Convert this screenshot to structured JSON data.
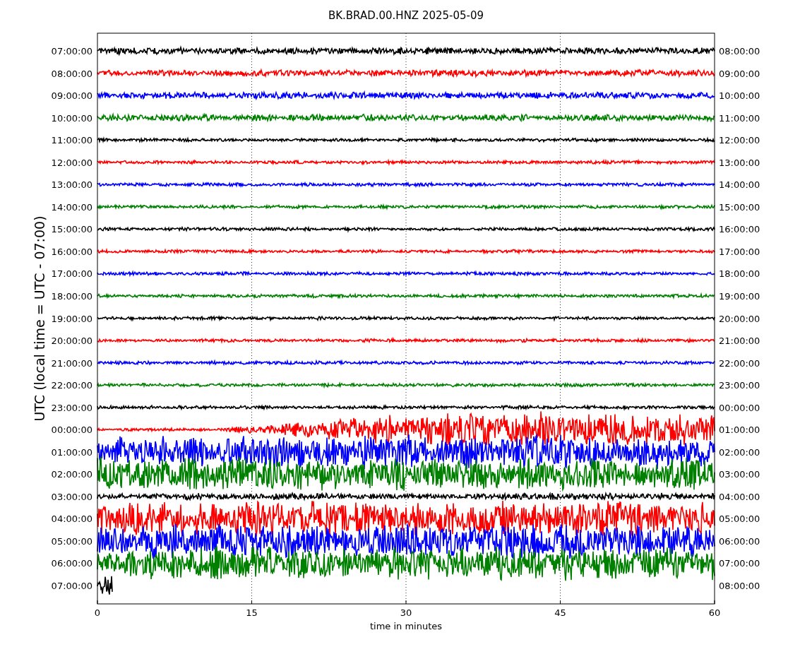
{
  "title": "BK.BRAD.00.HNZ 2025-05-09",
  "ylabel": "UTC (local time = UTC - 07:00)",
  "xlabel": "time in minutes",
  "xticks": [
    "0",
    "15",
    "30",
    "45",
    "60"
  ],
  "traces": [
    {
      "left": "07:00:00",
      "right": "08:00:00",
      "color": "#000000",
      "kind": "busy"
    },
    {
      "left": "08:00:00",
      "right": "09:00:00",
      "color": "#ff0000",
      "kind": "busy"
    },
    {
      "left": "09:00:00",
      "right": "10:00:00",
      "color": "#0000ff",
      "kind": "busy"
    },
    {
      "left": "10:00:00",
      "right": "11:00:00",
      "color": "#008000",
      "kind": "busy"
    },
    {
      "left": "11:00:00",
      "right": "12:00:00",
      "color": "#000000",
      "kind": "quiet"
    },
    {
      "left": "12:00:00",
      "right": "13:00:00",
      "color": "#ff0000",
      "kind": "quiet"
    },
    {
      "left": "13:00:00",
      "right": "14:00:00",
      "color": "#0000ff",
      "kind": "quiet"
    },
    {
      "left": "14:00:00",
      "right": "15:00:00",
      "color": "#008000",
      "kind": "quiet"
    },
    {
      "left": "15:00:00",
      "right": "16:00:00",
      "color": "#000000",
      "kind": "quiet"
    },
    {
      "left": "16:00:00",
      "right": "17:00:00",
      "color": "#ff0000",
      "kind": "quiet"
    },
    {
      "left": "17:00:00",
      "right": "18:00:00",
      "color": "#0000ff",
      "kind": "quiet"
    },
    {
      "left": "18:00:00",
      "right": "19:00:00",
      "color": "#008000",
      "kind": "quiet"
    },
    {
      "left": "19:00:00",
      "right": "20:00:00",
      "color": "#000000",
      "kind": "quiet"
    },
    {
      "left": "20:00:00",
      "right": "21:00:00",
      "color": "#ff0000",
      "kind": "quiet"
    },
    {
      "left": "21:00:00",
      "right": "22:00:00",
      "color": "#0000ff",
      "kind": "quiet"
    },
    {
      "left": "22:00:00",
      "right": "23:00:00",
      "color": "#008000",
      "kind": "quiet"
    },
    {
      "left": "23:00:00",
      "right": "00:00:00",
      "color": "#000000",
      "kind": "quiet"
    },
    {
      "left": "00:00:00",
      "right": "01:00:00",
      "color": "#ff0000",
      "kind": "rising"
    },
    {
      "left": "01:00:00",
      "right": "02:00:00",
      "color": "#0000ff",
      "kind": "storm"
    },
    {
      "left": "02:00:00",
      "right": "03:00:00",
      "color": "#008000",
      "kind": "storm"
    },
    {
      "left": "03:00:00",
      "right": "04:00:00",
      "color": "#000000",
      "kind": "busy"
    },
    {
      "left": "04:00:00",
      "right": "05:00:00",
      "color": "#ff0000",
      "kind": "storm"
    },
    {
      "left": "05:00:00",
      "right": "06:00:00",
      "color": "#0000ff",
      "kind": "storm"
    },
    {
      "left": "06:00:00",
      "right": "07:00:00",
      "color": "#008000",
      "kind": "storm"
    },
    {
      "left": "07:00:00",
      "right": "08:00:00",
      "color": "#000000",
      "kind": "partial"
    }
  ]
}
